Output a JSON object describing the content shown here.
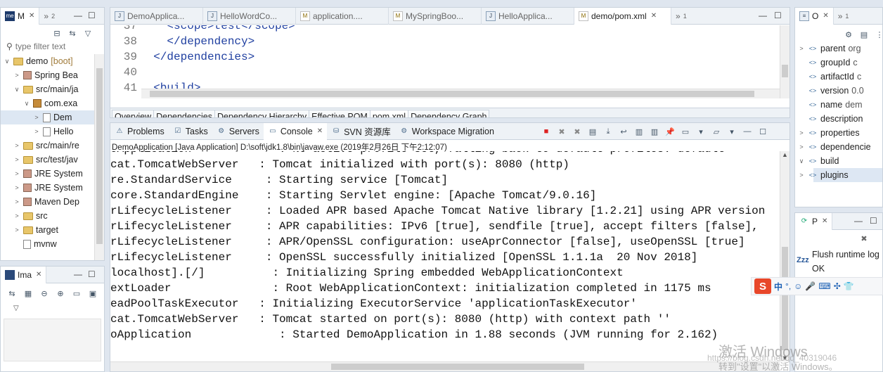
{
  "left_panel": {
    "tab_label": "M",
    "tab_more": "»",
    "tab_more_count": "2",
    "filter_placeholder": "type filter text",
    "tree": [
      {
        "label": "demo",
        "suffix": "[boot]",
        "level": 0,
        "twisty": "∨",
        "kind": "project"
      },
      {
        "label": "Spring Bea",
        "level": 1,
        "twisty": ">",
        "kind": "jar"
      },
      {
        "label": "src/main/ja",
        "level": 1,
        "twisty": "∨",
        "kind": "folder"
      },
      {
        "label": "com.exa",
        "level": 2,
        "twisty": "∨",
        "kind": "package"
      },
      {
        "label": "Dem",
        "level": 3,
        "twisty": ">",
        "kind": "file",
        "selected": true
      },
      {
        "label": "Hello",
        "level": 3,
        "twisty": ">",
        "kind": "file"
      },
      {
        "label": "src/main/re",
        "level": 1,
        "twisty": ">",
        "kind": "folder"
      },
      {
        "label": "src/test/jav",
        "level": 1,
        "twisty": ">",
        "kind": "folder"
      },
      {
        "label": "JRE System",
        "level": 1,
        "twisty": ">",
        "kind": "jar"
      },
      {
        "label": "JRE System",
        "level": 1,
        "twisty": ">",
        "kind": "jar"
      },
      {
        "label": "Maven Dep",
        "level": 1,
        "twisty": ">",
        "kind": "jar"
      },
      {
        "label": "src",
        "level": 1,
        "twisty": ">",
        "kind": "folder"
      },
      {
        "label": "target",
        "level": 1,
        "twisty": ">",
        "kind": "folder"
      },
      {
        "label": "mvnw",
        "level": 1,
        "twisty": "",
        "kind": "file"
      }
    ]
  },
  "image_panel": {
    "tab_label": "Ima"
  },
  "editor": {
    "tabs": [
      {
        "label": "DemoApplica...",
        "active": false
      },
      {
        "label": "HelloWordCo...",
        "active": false
      },
      {
        "label": "application....",
        "active": false
      },
      {
        "label": "MySpringBoo...",
        "active": false
      },
      {
        "label": "HelloApplica...",
        "active": false
      },
      {
        "label": "demo/pom.xml",
        "active": true
      }
    ],
    "more_tabs": "»",
    "more_count": "1",
    "lines": [
      {
        "num": "37",
        "text": "    <scope>test</scope>",
        "y": -8
      },
      {
        "num": "38",
        "text": "    </dependency>"
      },
      {
        "num": "39",
        "text": "  </dependencies>"
      },
      {
        "num": "40",
        "text": ""
      },
      {
        "num": "41",
        "text": "  <build>"
      }
    ],
    "subtabs": [
      {
        "label": "Overview",
        "active": false
      },
      {
        "label": "Dependencies",
        "active": false
      },
      {
        "label": "Dependency Hierarchy",
        "active": false
      },
      {
        "label": "Effective POM",
        "active": false
      },
      {
        "label": "pom.xml",
        "active": true
      },
      {
        "label": "Dependency Graph",
        "active": false
      }
    ]
  },
  "console": {
    "tabs": [
      {
        "label": "Problems",
        "active": false
      },
      {
        "label": "Tasks",
        "active": false
      },
      {
        "label": "Servers",
        "active": false
      },
      {
        "label": "Console",
        "active": true
      },
      {
        "label": "SVN 资源库",
        "active": false
      },
      {
        "label": "Workspace Migration",
        "active": false
      }
    ],
    "header": "DemoApplication [Java Application] D:\\soft\\jdk1.8\\bin\\javaw.exe (2019年2月26日 下午2:12:07)",
    "lines": [
      "oApplication             : No active profile set, falling back to default profiles: default",
      "cat.TomcatWebServer   : Tomcat initialized with port(s): 8080 (http)",
      "re.StandardService     : Starting service [Tomcat]",
      "core.StandardEngine    : Starting Servlet engine: [Apache Tomcat/9.0.16]",
      "rLifecycleListener     : Loaded APR based Apache Tomcat Native library [1.2.21] using APR version",
      "rLifecycleListener     : APR capabilities: IPv6 [true], sendfile [true], accept filters [false],",
      "rLifecycleListener     : APR/OpenSSL configuration: useAprConnector [false], useOpenSSL [true]",
      "rLifecycleListener     : OpenSSL successfully initialized [OpenSSL 1.1.1a  20 Nov 2018]",
      "localhost].[/]          : Initializing Spring embedded WebApplicationContext",
      "extLoader               : Root WebApplicationContext: initialization completed in 1175 ms",
      "eadPoolTaskExecutor   : Initializing ExecutorService 'applicationTaskExecutor'",
      "cat.TomcatWebServer   : Tomcat started on port(s): 8080 (http) with context path ''",
      "oApplication             : Started DemoApplication in 1.88 seconds (JVM running for 2.162)"
    ]
  },
  "outline": {
    "tab_label": "O",
    "more": "»",
    "more_count": "1",
    "rows": [
      {
        "label": "parent",
        "suffix": "org",
        "twisty": ">"
      },
      {
        "label": "groupId",
        "suffix": "c",
        "twisty": ""
      },
      {
        "label": "artifactId",
        "suffix": "c",
        "twisty": ""
      },
      {
        "label": "version",
        "suffix": "0.0",
        "twisty": ""
      },
      {
        "label": "name",
        "suffix": "dem",
        "twisty": ""
      },
      {
        "label": "description",
        "suffix": "",
        "twisty": ""
      },
      {
        "label": "properties",
        "suffix": "",
        "twisty": ">"
      },
      {
        "label": "dependencie",
        "suffix": "",
        "twisty": ">"
      },
      {
        "label": "build",
        "suffix": "",
        "twisty": "∨"
      },
      {
        "label": "plugins",
        "suffix": "",
        "twisty": ">",
        "selected": true
      }
    ]
  },
  "progress": {
    "tab_label": "P",
    "message": "Flush runtime log",
    "status": "OK",
    "zzz": "Zzz"
  },
  "ime": {
    "logo": "S",
    "mode": "中",
    "punct": "°,"
  },
  "watermark": {
    "line1": "激活 Windows",
    "line2": "转到\"设置\"以激活 Windows。",
    "url": "https://blog.csdn.net/qq_40319046"
  }
}
